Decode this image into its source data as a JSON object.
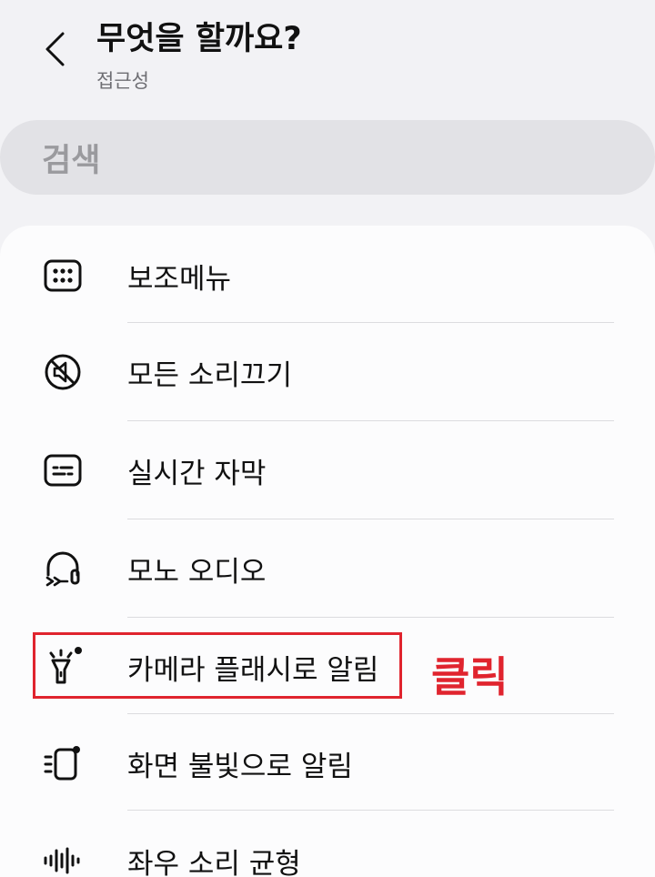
{
  "header": {
    "title": "무엇을 할까요?",
    "subtitle": "접근성"
  },
  "search": {
    "placeholder": "검색"
  },
  "menu": {
    "items": [
      {
        "label": "보조메뉴",
        "icon": "assistant-menu-icon"
      },
      {
        "label": "모든 소리끄기",
        "icon": "mute-icon"
      },
      {
        "label": "실시간 자막",
        "icon": "caption-icon"
      },
      {
        "label": "모노 오디오",
        "icon": "headset-icon"
      },
      {
        "label": "카메라 플래시로 알림",
        "icon": "flashlight-icon"
      },
      {
        "label": "화면 불빛으로 알림",
        "icon": "screen-flash-icon"
      },
      {
        "label": "좌우 소리 균형",
        "icon": "sound-balance-icon"
      }
    ]
  },
  "annotation": {
    "text": "클릭",
    "color": "#e0242e"
  }
}
